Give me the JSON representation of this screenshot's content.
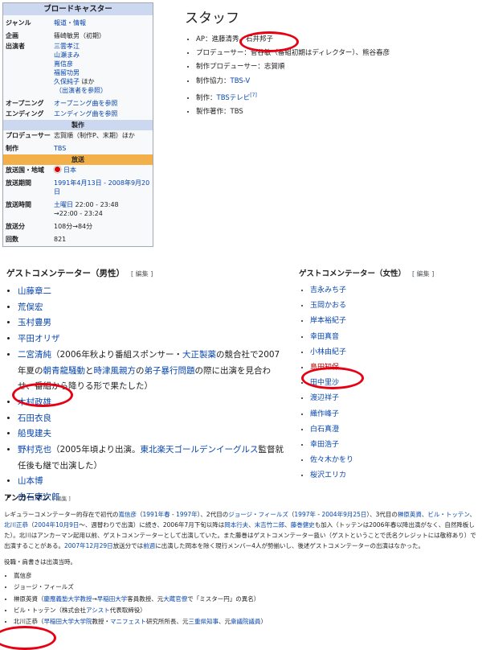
{
  "infobox": {
    "title": "ブロードキャスター",
    "rows1": [
      {
        "label": "ジャンル",
        "value": "報道・情報",
        "link": true
      },
      {
        "label": "企画",
        "value": "篠崎敏男（初期）",
        "link": false
      }
    ],
    "cast_label": "出演者",
    "cast": [
      "三雲孝江",
      "山瀬まみ",
      "嶌信彦",
      "福留功男"
    ],
    "cast_tail": "久保純子",
    "cast_tail_suffix": " ほか",
    "cast_note": "（出演者を参照）",
    "opening_label": "オープニング",
    "opening_value": "オープニング曲を参照",
    "ending_label": "エンディング",
    "ending_value": "エンディング曲を参照",
    "production_header": "製作",
    "producer_label": "プロデューサー",
    "producer_value": "志賀順（制作P、末期）ほか",
    "seisaku_label": "制作",
    "seisaku_value": "TBS",
    "broadcast_header": "放送",
    "country_label": "放送国・地域",
    "country_value": "日本",
    "period_label": "放送期間",
    "period_value": "1991年4月13日 - 2008年9月20日",
    "time_label": "放送時間",
    "time_day": "土曜日",
    "time_value1": " 22:00 - 23:48",
    "time_value2": "→22:00 - 23:24",
    "minutes_label": "放送分",
    "minutes_value": "108分→84分",
    "episodes_label": "回数",
    "episodes_value": "821"
  },
  "staff": {
    "heading": "スタッフ",
    "items": [
      {
        "parts": [
          {
            "t": "AP：進藤清秀、石井邦子",
            "link": false
          }
        ]
      },
      {
        "parts": [
          {
            "t": "プロデューサー：菅谷敏（番組初期はディレクター）、熊谷春彦",
            "link": false
          }
        ]
      },
      {
        "parts": [
          {
            "t": "制作プロデューサー：志賀順",
            "link": false
          }
        ]
      },
      {
        "parts": [
          {
            "t": "制作協力：",
            "link": false
          },
          {
            "t": "TBS-V",
            "link": true
          }
        ]
      },
      {
        "parts": [
          {
            "t": "制作：",
            "link": false
          },
          {
            "t": "TBSテレビ",
            "link": true
          },
          {
            "t": "[7]",
            "link": true,
            "sup": true
          }
        ]
      },
      {
        "parts": [
          {
            "t": "製作著作：TBS",
            "link": false
          }
        ]
      }
    ]
  },
  "male": {
    "heading": "ゲストコメンテーター（男性）",
    "edit": "[ 編集 ]",
    "items": [
      {
        "parts": [
          {
            "t": "山藤章二",
            "link": true
          }
        ]
      },
      {
        "parts": [
          {
            "t": "荒俣宏",
            "link": true
          }
        ]
      },
      {
        "parts": [
          {
            "t": "玉村豊男",
            "link": true
          }
        ]
      },
      {
        "parts": [
          {
            "t": "平田オリザ",
            "link": true
          }
        ]
      },
      {
        "parts": [
          {
            "t": "二宮清純",
            "link": true
          },
          {
            "t": "（2006年秋より番組スポンサー・",
            "link": false
          },
          {
            "t": "大正製薬",
            "link": true
          },
          {
            "t": "の競合社で2007年夏の",
            "link": false
          },
          {
            "t": "朝青龍騒動",
            "link": true
          },
          {
            "t": "と",
            "link": false
          },
          {
            "t": "時津風親方",
            "link": true
          },
          {
            "t": "の",
            "link": false
          },
          {
            "t": "弟子暴行問題",
            "link": true
          },
          {
            "t": "の際に出演を見合わせ、番組から降りる形で果たした）",
            "link": false
          }
        ]
      },
      {
        "parts": [
          {
            "t": "木村政雄",
            "link": true
          }
        ]
      },
      {
        "parts": [
          {
            "t": "石田衣良",
            "link": true
          }
        ]
      },
      {
        "parts": [
          {
            "t": "船曳建夫",
            "link": true
          }
        ]
      },
      {
        "parts": [
          {
            "t": "野村克也",
            "link": true
          },
          {
            "t": "（2005年頃より出演。",
            "link": false
          },
          {
            "t": "東北楽天ゴールデンイーグルス",
            "link": true
          },
          {
            "t": "監督就任後も継で出演した）",
            "link": false
          }
        ]
      },
      {
        "parts": [
          {
            "t": "山本博",
            "link": true
          }
        ]
      },
      {
        "parts": [
          {
            "t": "白石康次郎",
            "link": true
          }
        ]
      }
    ]
  },
  "female": {
    "heading": "ゲストコメンテーター（女性）",
    "edit": "[ 編集 ]",
    "items": [
      {
        "t": "吉永みち子",
        "red": false
      },
      {
        "t": "玉岡かおる",
        "red": false
      },
      {
        "t": "岸本裕紀子",
        "red": false
      },
      {
        "t": "幸田真音",
        "red": false
      },
      {
        "t": "小林由紀子",
        "red": false
      },
      {
        "t": "島田知保",
        "red": true
      },
      {
        "t": "田中里沙",
        "red": false
      },
      {
        "t": "渡辺祥子",
        "red": false
      },
      {
        "t": "織作峰子",
        "red": false
      },
      {
        "t": "白石真澄",
        "red": false
      },
      {
        "t": "幸田浩子",
        "red": false
      },
      {
        "t": "佐々木かをり",
        "red": false
      },
      {
        "t": "桜沢エリカ",
        "red": false
      }
    ]
  },
  "anchor": {
    "heading": "アンカーマン",
    "edit": "[ 編集 ]",
    "paragraph": [
      {
        "t": "レギュラーコメンテーター的存在で初代の",
        "link": false
      },
      {
        "t": "嶌信彦",
        "link": true
      },
      {
        "t": "（",
        "link": false
      },
      {
        "t": "1991年春",
        "link": true
      },
      {
        "t": " - ",
        "link": false
      },
      {
        "t": "1997年",
        "link": true
      },
      {
        "t": "）、2代目の",
        "link": false
      },
      {
        "t": "ジョージ・フィールズ",
        "link": true
      },
      {
        "t": "（",
        "link": false
      },
      {
        "t": "1997年",
        "link": true
      },
      {
        "t": " - ",
        "link": false
      },
      {
        "t": "2004年9月25日",
        "link": true
      },
      {
        "t": "）、3代目の",
        "link": false
      },
      {
        "t": "榊原英資",
        "link": true
      },
      {
        "t": "、",
        "link": false
      },
      {
        "t": "ビル・トッテン",
        "link": true
      },
      {
        "t": "、",
        "link": false
      },
      {
        "t": "北川正恭",
        "link": true
      },
      {
        "t": "（",
        "link": false
      },
      {
        "t": "2004年10月9日",
        "link": true
      },
      {
        "t": "〜、週替わりで出演）に続き、2006年7月下旬以降は",
        "link": false
      },
      {
        "t": "岡本行夫",
        "link": true
      },
      {
        "t": "、",
        "link": false
      },
      {
        "t": "末吉竹二郎",
        "link": true
      },
      {
        "t": "、",
        "link": false
      },
      {
        "t": "藤巻健史",
        "link": true
      },
      {
        "t": "も加入（トッテンは2006年春以降出演がなく、自然降板した）。北川はアンカーマン起用以前、ゲストコメンテーターとして出演していた。また藤巻はゲストコメンテーター扱い（ゲストということで氏名クレジットには敬称あり）で出演することがある。",
        "link": false
      },
      {
        "t": "2007年12月29日",
        "link": true
      },
      {
        "t": "放送分では",
        "link": false
      },
      {
        "t": "前週",
        "link": true
      },
      {
        "t": "に出演した岡本を除く現行メンバー4人が勢揃いし、後述ゲストコメンテーターの出演はなかった。",
        "link": false
      }
    ],
    "note": "役職・肩書きは出演当時。",
    "items": [
      [
        {
          "t": "嶌信彦",
          "link": false
        }
      ],
      [
        {
          "t": "ジョージ・フィールズ",
          "link": false
        }
      ],
      [
        {
          "t": "榊原英資（",
          "link": false
        },
        {
          "t": "慶應義塾大学教授",
          "link": true
        },
        {
          "t": "→",
          "link": false
        },
        {
          "t": "早稲田大学",
          "link": true
        },
        {
          "t": "客員教授、元",
          "link": false
        },
        {
          "t": "大蔵官僚",
          "link": true
        },
        {
          "t": "で「ミスター円」の異名）",
          "link": false
        }
      ],
      [
        {
          "t": "ビル・トッテン（株式会社",
          "link": false
        },
        {
          "t": "アシスト",
          "link": true
        },
        {
          "t": "代表取締役）",
          "link": false
        }
      ],
      [
        {
          "t": "北川正恭（",
          "link": false
        },
        {
          "t": "早稲田大学大学院",
          "link": true
        },
        {
          "t": "教授・",
          "link": false
        },
        {
          "t": "マニフェスト",
          "link": true
        },
        {
          "t": "研究所所長、元",
          "link": false
        },
        {
          "t": "三重県知事",
          "link": true
        },
        {
          "t": "、元",
          "link": false
        },
        {
          "t": "衆議院議員",
          "link": true
        },
        {
          "t": "）",
          "link": false
        }
      ]
    ]
  },
  "colors": {
    "link": "#0645ad",
    "redlink": "#ba0000",
    "highlight_circle": "#e60012",
    "infobox_title_bg": "#ccd8f0",
    "broadcast_header_bg": "#f3b04a"
  }
}
